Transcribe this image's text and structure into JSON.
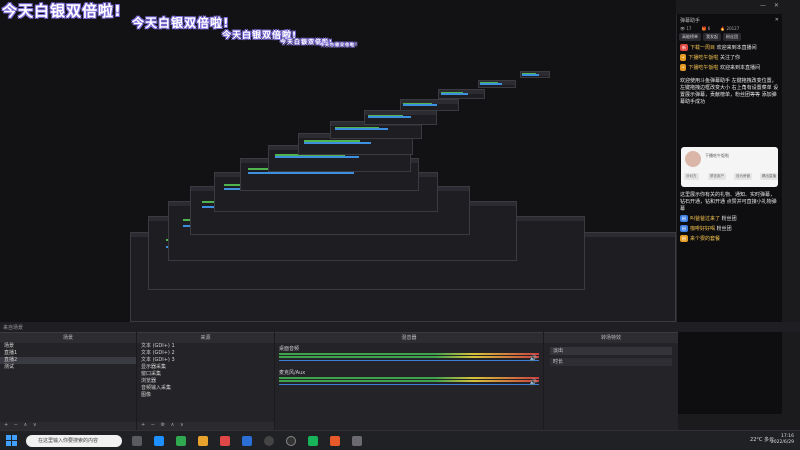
{
  "overlay": {
    "title": "今天白银双倍啦!"
  },
  "chat": {
    "header_title": "弹幕助手",
    "stats": [
      "17",
      "6",
      "20127"
    ],
    "tabs": [
      "高能榜单",
      "我发起",
      "粉丝团"
    ],
    "messages": [
      {
        "badge": "新",
        "name": "下载一周目",
        "text": "欢迎来到本直播间"
      },
      {
        "badge": "",
        "name": "下播吃午饭啦",
        "text": "关注了你"
      },
      {
        "badge": "",
        "name": "下播吃午饭啦",
        "text": "欢迎来到本直播间"
      }
    ],
    "info_text": "欢迎使用斗鱼弹幕助手 左键拖拽改变位置，左键拖拽边框改变大小 右上角有设置菜单 设置展示弹幕，贡献榜单，粉丝团等等 添加弹幕助手成功",
    "card": {
      "name": "下播吃午饭啦",
      "buttons": [
        "@对方",
        "禁言用户",
        "设为房管",
        "踢出直播"
      ]
    },
    "footer_text": "这里展示你有关的礼物、通知、实时弹幕，钻石开通，钻和开通 点赞并可直接小礼物弹幕",
    "events": [
      {
        "badge": "粉",
        "text": "叫爸爸过来了",
        "tail": "粉丝团"
      },
      {
        "badge": "粉",
        "text": "咖啡好好喝",
        "tail": "粉丝团"
      },
      {
        "badge": "粉",
        "text": "来个狠的套餐",
        "tail": ""
      }
    ]
  },
  "docks": {
    "scenes": {
      "title": "场景",
      "items": [
        "场景",
        "直播1",
        "直播2",
        "测试"
      ]
    },
    "sources": {
      "title": "来源",
      "items": [
        "文本 (GDI+) 1",
        "文本 (GDI+) 2",
        "文本 (GDI+) 3",
        "显示器采集",
        "窗口采集",
        "浏览器",
        "音频输入采集",
        "图像",
        "媒体源"
      ]
    },
    "mixer": {
      "title": "混音器",
      "tracks": [
        "桌面音频",
        "麦克风/Aux"
      ]
    },
    "transitions": {
      "title": "转场特效",
      "label": "淡出",
      "duration_label": "时长"
    },
    "header_left": "来自场景"
  },
  "taskbar": {
    "search_placeholder": "在这里输入你要搜索的内容",
    "weather": "22°C 多云",
    "time": "17:16",
    "date": "2022/6/29"
  },
  "colors": {
    "accent_blue": "#3d8fe0",
    "meter_green": "#3fa34d",
    "title_stroke": "#7b6bd9"
  }
}
